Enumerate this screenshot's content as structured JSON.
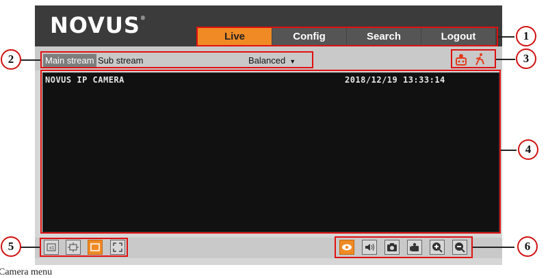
{
  "header": {
    "logo": "NOVUS",
    "nav": [
      {
        "label": "Live",
        "active": true
      },
      {
        "label": "Config"
      },
      {
        "label": "Search"
      },
      {
        "label": "Logout"
      }
    ]
  },
  "toolbar": {
    "main_stream": "Main stream",
    "sub_stream": "Sub stream",
    "quality": "Balanced"
  },
  "video": {
    "osd_title": "NOVUS IP CAMERA",
    "osd_time": "2018/12/19 13:33:14"
  },
  "callouts": [
    "1",
    "2",
    "3",
    "4",
    "5",
    "6"
  ],
  "caption": "Camera menu",
  "colors": {
    "accent": "#f08a24",
    "annotation": "#e01010"
  }
}
